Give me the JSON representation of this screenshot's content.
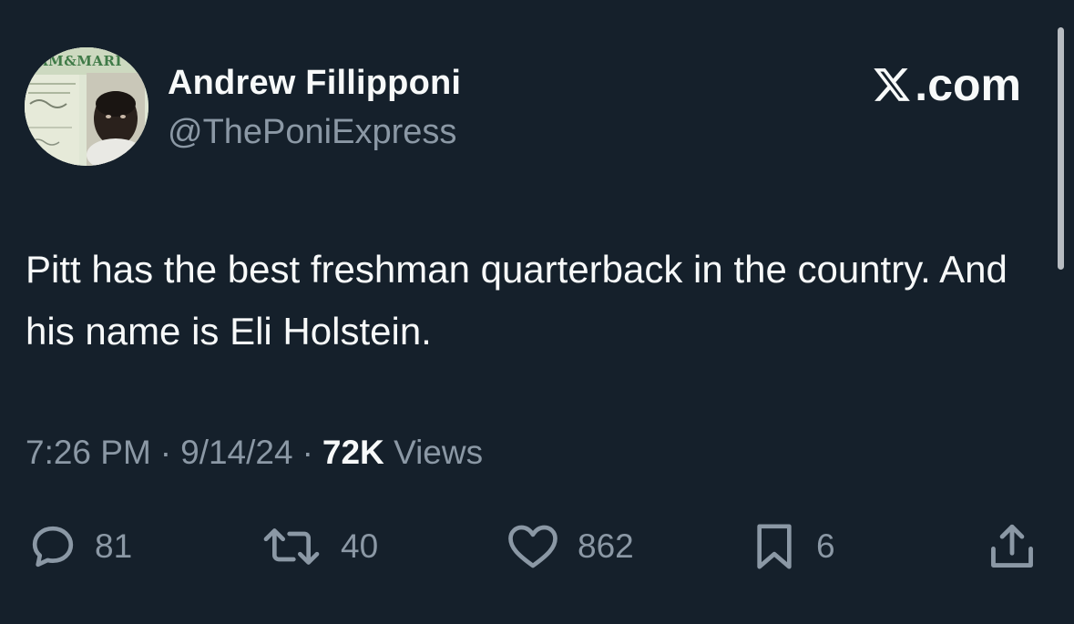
{
  "author": {
    "name": "Andrew Fillipponi",
    "handle": "@ThePoniExpress",
    "avatar_text": "AM&MARI"
  },
  "brand": {
    "label": ".com",
    "icon": "x-logo-icon"
  },
  "tweet": {
    "text": "Pitt has the best freshman quarterback in the country. And his name is Eli Holstein."
  },
  "meta": {
    "time": "7:26 PM",
    "separator": "·",
    "date": "9/14/24",
    "views_count": "72K",
    "views_label": "Views"
  },
  "actions": {
    "replies": "81",
    "reposts": "40",
    "likes": "862",
    "bookmarks": "6"
  },
  "colors": {
    "background": "#15202b",
    "text": "#f7f9f9",
    "muted": "#8b98a5"
  }
}
